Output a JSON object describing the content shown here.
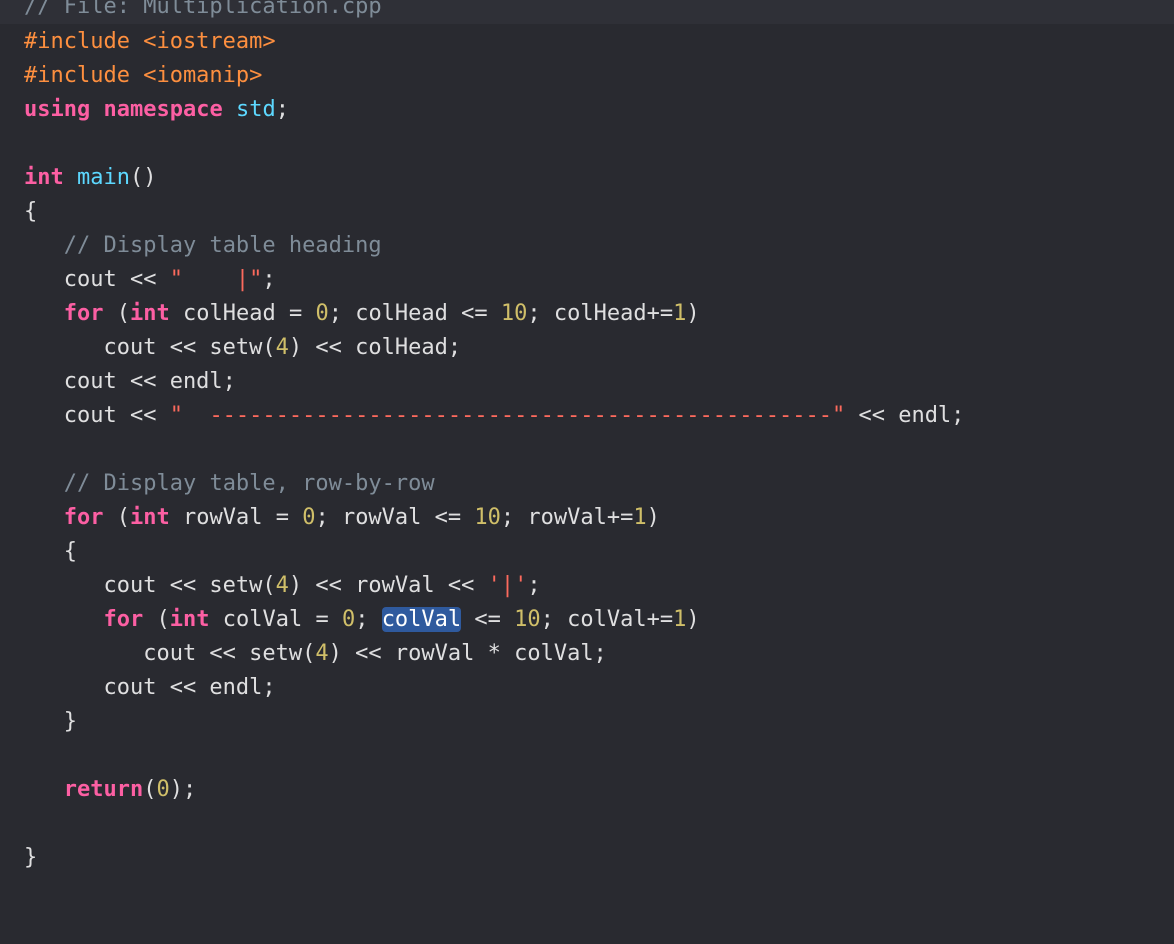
{
  "header": {
    "file_comment": "// File: Multiplication.cpp"
  },
  "colors": {
    "background": "#292a30",
    "keyword": "#fc5fa3",
    "preprocessor": "#fd8f3f",
    "string": "#fc6a5d",
    "number": "#d0bf69",
    "comment": "#7f8c98",
    "identifier": "#67b7a4",
    "function": "#5dd8ff",
    "plain": "#dfdfe0",
    "selection": "#2f5a9e"
  },
  "code": {
    "lines": [
      [
        {
          "t": "#include <iostream>",
          "k": "pre"
        }
      ],
      [
        {
          "t": "#include <iomanip>",
          "k": "pre"
        }
      ],
      [
        {
          "t": "using",
          "k": "kw"
        },
        {
          "t": " ",
          "k": "plain"
        },
        {
          "t": "namespace",
          "k": "kw"
        },
        {
          "t": " ",
          "k": "plain"
        },
        {
          "t": "std",
          "k": "fn"
        },
        {
          "t": ";",
          "k": "plain"
        }
      ],
      [],
      [
        {
          "t": "int",
          "k": "kw"
        },
        {
          "t": " ",
          "k": "plain"
        },
        {
          "t": "main",
          "k": "fn"
        },
        {
          "t": "()",
          "k": "plain"
        }
      ],
      [
        {
          "t": "{",
          "k": "plain"
        }
      ],
      [
        {
          "t": "   ",
          "k": "plain"
        },
        {
          "t": "// Display table heading",
          "k": "com"
        }
      ],
      [
        {
          "t": "   cout << ",
          "k": "plain"
        },
        {
          "t": "\"    |\"",
          "k": "str"
        },
        {
          "t": ";",
          "k": "plain"
        }
      ],
      [
        {
          "t": "   ",
          "k": "plain"
        },
        {
          "t": "for",
          "k": "kw"
        },
        {
          "t": " (",
          "k": "plain"
        },
        {
          "t": "int",
          "k": "kw"
        },
        {
          "t": " colHead = ",
          "k": "plain"
        },
        {
          "t": "0",
          "k": "num"
        },
        {
          "t": "; colHead <= ",
          "k": "plain"
        },
        {
          "t": "10",
          "k": "num"
        },
        {
          "t": "; colHead+=",
          "k": "plain"
        },
        {
          "t": "1",
          "k": "num"
        },
        {
          "t": ")",
          "k": "plain"
        }
      ],
      [
        {
          "t": "      cout << setw(",
          "k": "plain"
        },
        {
          "t": "4",
          "k": "num"
        },
        {
          "t": ") << colHead;",
          "k": "plain"
        }
      ],
      [
        {
          "t": "   cout << endl;",
          "k": "plain"
        }
      ],
      [
        {
          "t": "   cout << ",
          "k": "plain"
        },
        {
          "t": "\"  -----------------------------------------------\"",
          "k": "str"
        },
        {
          "t": " << endl;",
          "k": "plain"
        }
      ],
      [],
      [
        {
          "t": "   ",
          "k": "plain"
        },
        {
          "t": "// Display table, row-by-row",
          "k": "com"
        }
      ],
      [
        {
          "t": "   ",
          "k": "plain"
        },
        {
          "t": "for",
          "k": "kw"
        },
        {
          "t": " (",
          "k": "plain"
        },
        {
          "t": "int",
          "k": "kw"
        },
        {
          "t": " rowVal = ",
          "k": "plain"
        },
        {
          "t": "0",
          "k": "num"
        },
        {
          "t": "; rowVal <= ",
          "k": "plain"
        },
        {
          "t": "10",
          "k": "num"
        },
        {
          "t": "; rowVal+=",
          "k": "plain"
        },
        {
          "t": "1",
          "k": "num"
        },
        {
          "t": ")",
          "k": "plain"
        }
      ],
      [
        {
          "t": "   {",
          "k": "plain"
        }
      ],
      [
        {
          "t": "      cout << setw(",
          "k": "plain"
        },
        {
          "t": "4",
          "k": "num"
        },
        {
          "t": ") << rowVal << ",
          "k": "plain"
        },
        {
          "t": "'|'",
          "k": "str"
        },
        {
          "t": ";",
          "k": "plain"
        }
      ],
      [
        {
          "t": "      ",
          "k": "plain"
        },
        {
          "t": "for",
          "k": "kw"
        },
        {
          "t": " (",
          "k": "plain"
        },
        {
          "t": "int",
          "k": "kw"
        },
        {
          "t": " colVal = ",
          "k": "plain"
        },
        {
          "t": "0",
          "k": "num"
        },
        {
          "t": "; ",
          "k": "plain"
        },
        {
          "t": "colVal",
          "k": "sel"
        },
        {
          "t": " <= ",
          "k": "plain"
        },
        {
          "t": "10",
          "k": "num"
        },
        {
          "t": "; colVal+=",
          "k": "plain"
        },
        {
          "t": "1",
          "k": "num"
        },
        {
          "t": ")",
          "k": "plain"
        }
      ],
      [
        {
          "t": "         cout << setw(",
          "k": "plain"
        },
        {
          "t": "4",
          "k": "num"
        },
        {
          "t": ") << rowVal * colVal;",
          "k": "plain"
        }
      ],
      [
        {
          "t": "      cout << endl;",
          "k": "plain"
        }
      ],
      [
        {
          "t": "   }",
          "k": "plain"
        }
      ],
      [],
      [
        {
          "t": "   ",
          "k": "plain"
        },
        {
          "t": "return",
          "k": "kw"
        },
        {
          "t": "(",
          "k": "plain"
        },
        {
          "t": "0",
          "k": "num"
        },
        {
          "t": ");",
          "k": "plain"
        }
      ],
      [],
      [
        {
          "t": "}",
          "k": "plain"
        }
      ]
    ]
  }
}
